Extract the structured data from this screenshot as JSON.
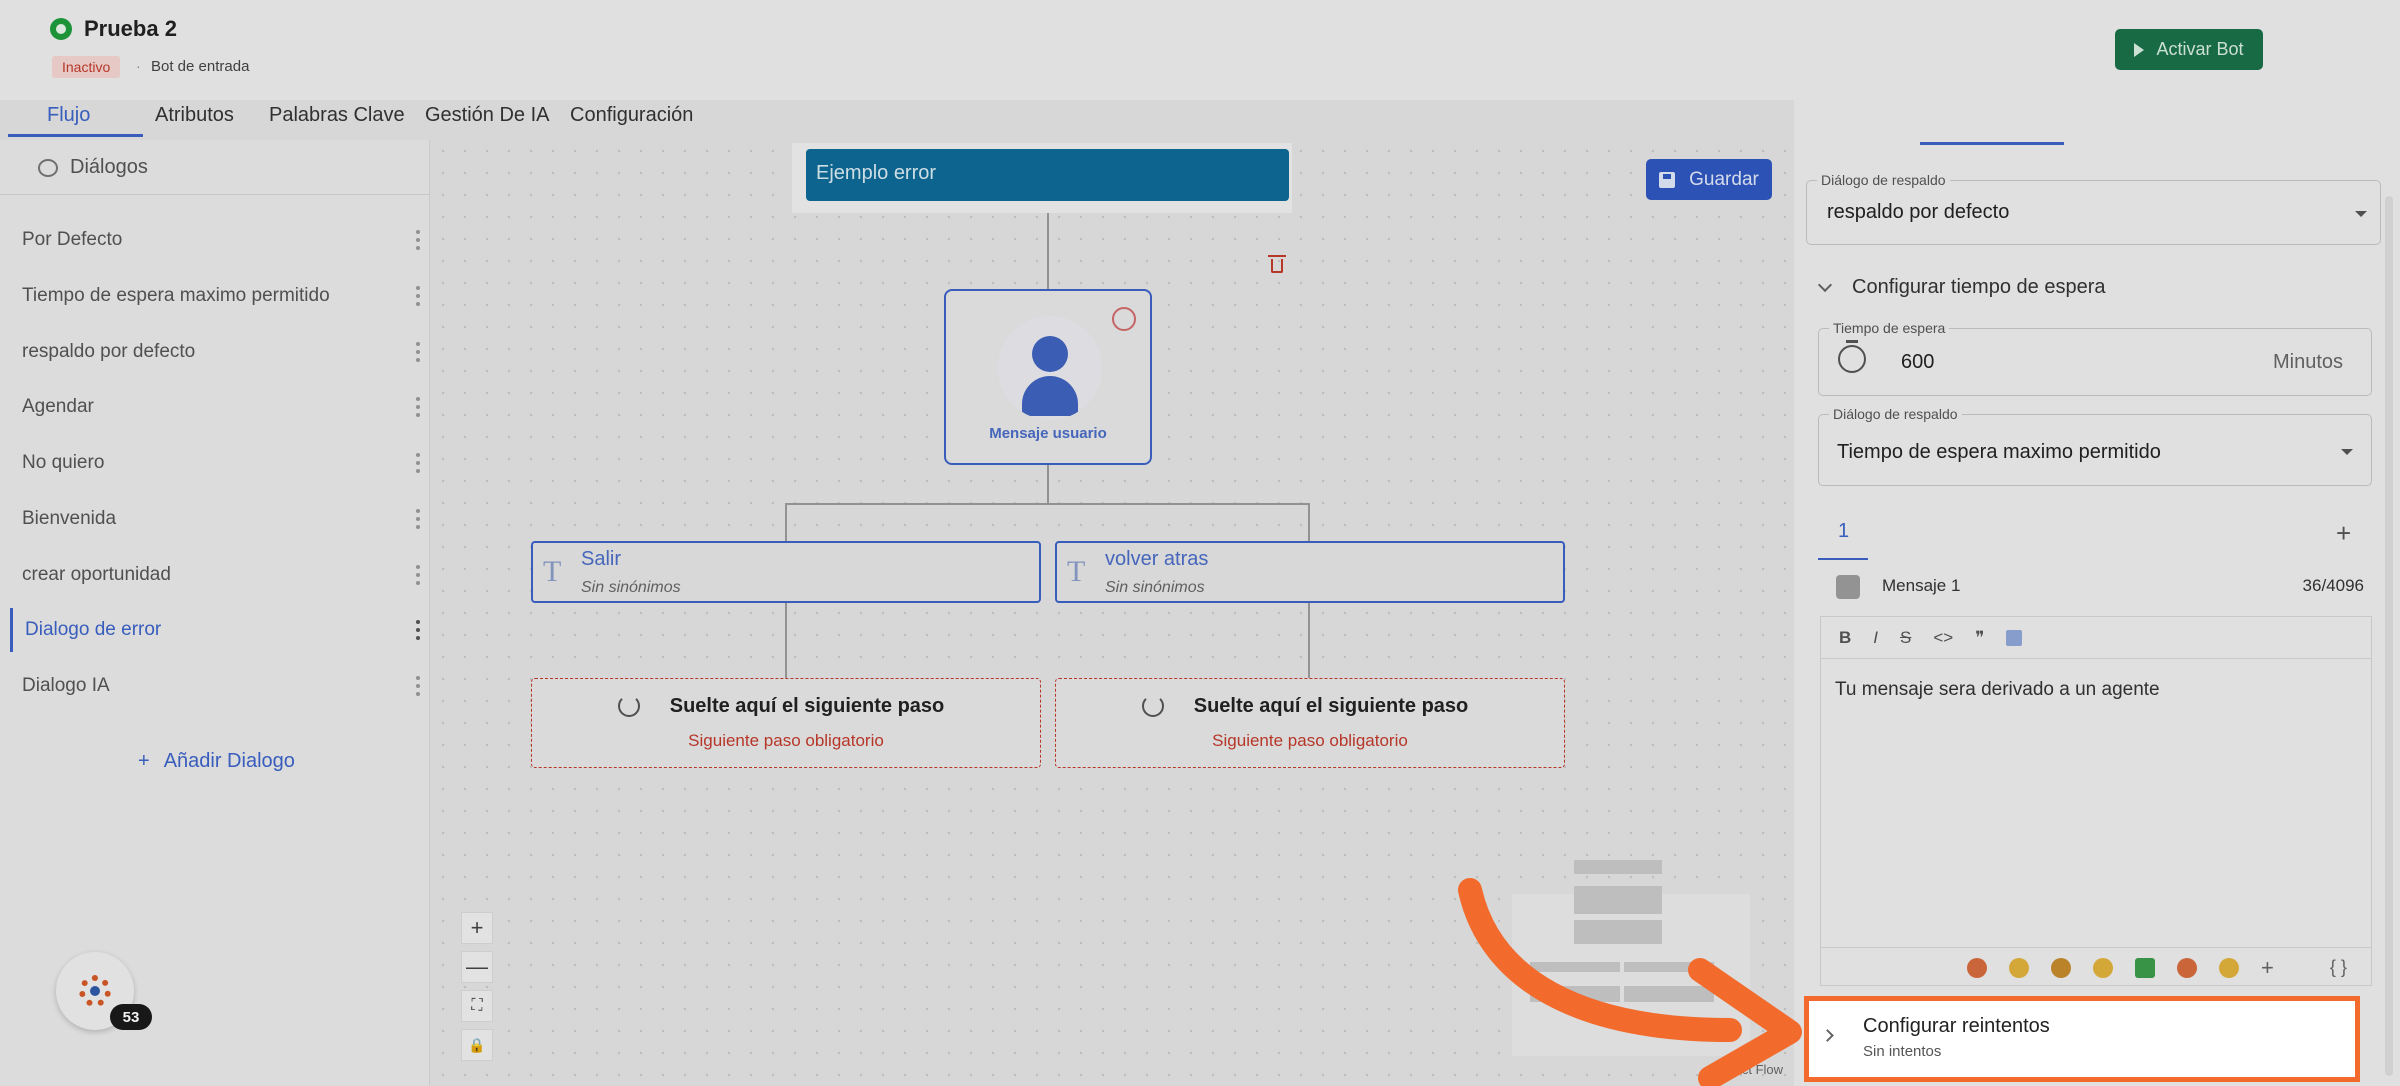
{
  "header": {
    "bot_name": "Prueba 2",
    "status_badge": "Inactivo",
    "separator": "·",
    "bot_type": "Bot de entrada",
    "activate_label": "Activar Bot"
  },
  "tabs": [
    {
      "label": "Flujo",
      "active": true
    },
    {
      "label": "Atributos"
    },
    {
      "label": "Palabras Clave"
    },
    {
      "label": "Gestión De IA"
    },
    {
      "label": "Configuración"
    }
  ],
  "sidebar": {
    "title": "Diálogos",
    "items": [
      {
        "label": "Por Defecto"
      },
      {
        "label": "Tiempo de espera maximo permitido"
      },
      {
        "label": "respaldo por defecto"
      },
      {
        "label": "Agendar"
      },
      {
        "label": "No quiero"
      },
      {
        "label": "Bienvenida"
      },
      {
        "label": "crear oportunidad"
      },
      {
        "label": "Dialogo de error",
        "active": true
      },
      {
        "label": "Dialogo IA"
      }
    ],
    "add_label": "Añadir Dialogo",
    "add_icon": "+"
  },
  "canvas": {
    "save_label": "Guardar",
    "start_node": "Ejemplo error",
    "user_node_label": "Mensaje usuario",
    "keywords": [
      {
        "icon": "T",
        "name": "Salir",
        "synonyms": "Sin sinónimos"
      },
      {
        "icon": "T",
        "name": "volver atras",
        "synonyms": "Sin sinónimos"
      }
    ],
    "drop_targets": [
      {
        "title": "Suelte aquí el siguiente paso",
        "required": "Siguiente paso obligatorio"
      },
      {
        "title": "Suelte aquí el siguiente paso",
        "required": "Siguiente paso obligatorio"
      }
    ],
    "controls": {
      "zoom_in": "+",
      "zoom_out": "—",
      "fit": "⛶",
      "lock": "🔒"
    },
    "attribution": "React Flow"
  },
  "chat_widget": {
    "count": "53"
  },
  "panel": {
    "fallback_label": "Diálogo de respaldo",
    "fallback_value": "respaldo por defecto",
    "timeout_section": "Configurar tiempo de espera",
    "timeout_label": "Tiempo de espera",
    "timeout_value": "600",
    "timeout_unit": "Minutos",
    "timeout_fallback_label": "Diálogo de respaldo",
    "timeout_fallback_value": "Tiempo de espera maximo permitido",
    "message_tab": "1",
    "add_message": "+",
    "message_title": "Mensaje 1",
    "message_count": "36/4096",
    "toolbar": {
      "bold": "B",
      "italic": "I",
      "strike": "S",
      "code": "<>",
      "quote": "❞"
    },
    "message_text": "Tu mensaje sera derivado a un agente",
    "emoji_plus": "+",
    "variables": "{ }",
    "retries_title": "Configurar reintentos",
    "retries_sub": "Sin intentos"
  },
  "colors": {
    "accent": "#3b63c7",
    "activate_bg": "#1a7048",
    "start_node_bg": "#0e6a96",
    "danger": "#c0392b",
    "highlight": "#f26b2d"
  }
}
